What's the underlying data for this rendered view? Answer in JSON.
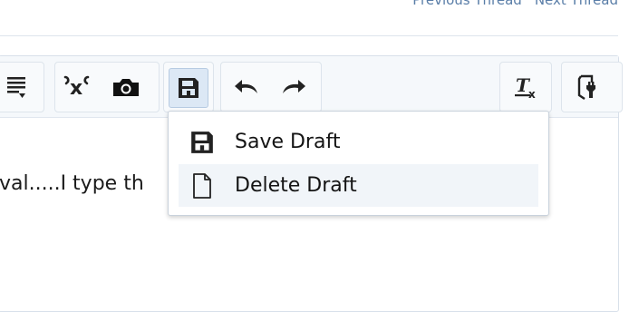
{
  "nav": {
    "previous_label": "Previous Thread",
    "next_label": "Next Thread"
  },
  "toolbar": {
    "buttons": [
      {
        "icon": "format-icon",
        "active": false
      },
      {
        "icon": "bbcode-icon",
        "active": false
      },
      {
        "icon": "camera-icon",
        "active": false
      },
      {
        "icon": "floppy-disk-icon",
        "active": true
      },
      {
        "icon": "undo-icon",
        "active": false
      },
      {
        "icon": "redo-icon",
        "active": false
      },
      {
        "icon": "remove-formatting-icon",
        "active": false
      },
      {
        "icon": "settings-toggle-icon",
        "active": false
      }
    ]
  },
  "editor": {
    "content_text": "val.....I type th"
  },
  "draft_menu": {
    "items": [
      {
        "icon": "floppy-disk-icon",
        "label": "Save Draft",
        "hovered": false
      },
      {
        "icon": "document-icon",
        "label": "Delete Draft",
        "hovered": true
      }
    ]
  },
  "colors": {
    "link": "#5a7ea8",
    "active_button_bg": "#dce8f5",
    "hover_item_bg": "#f1f5f9"
  }
}
